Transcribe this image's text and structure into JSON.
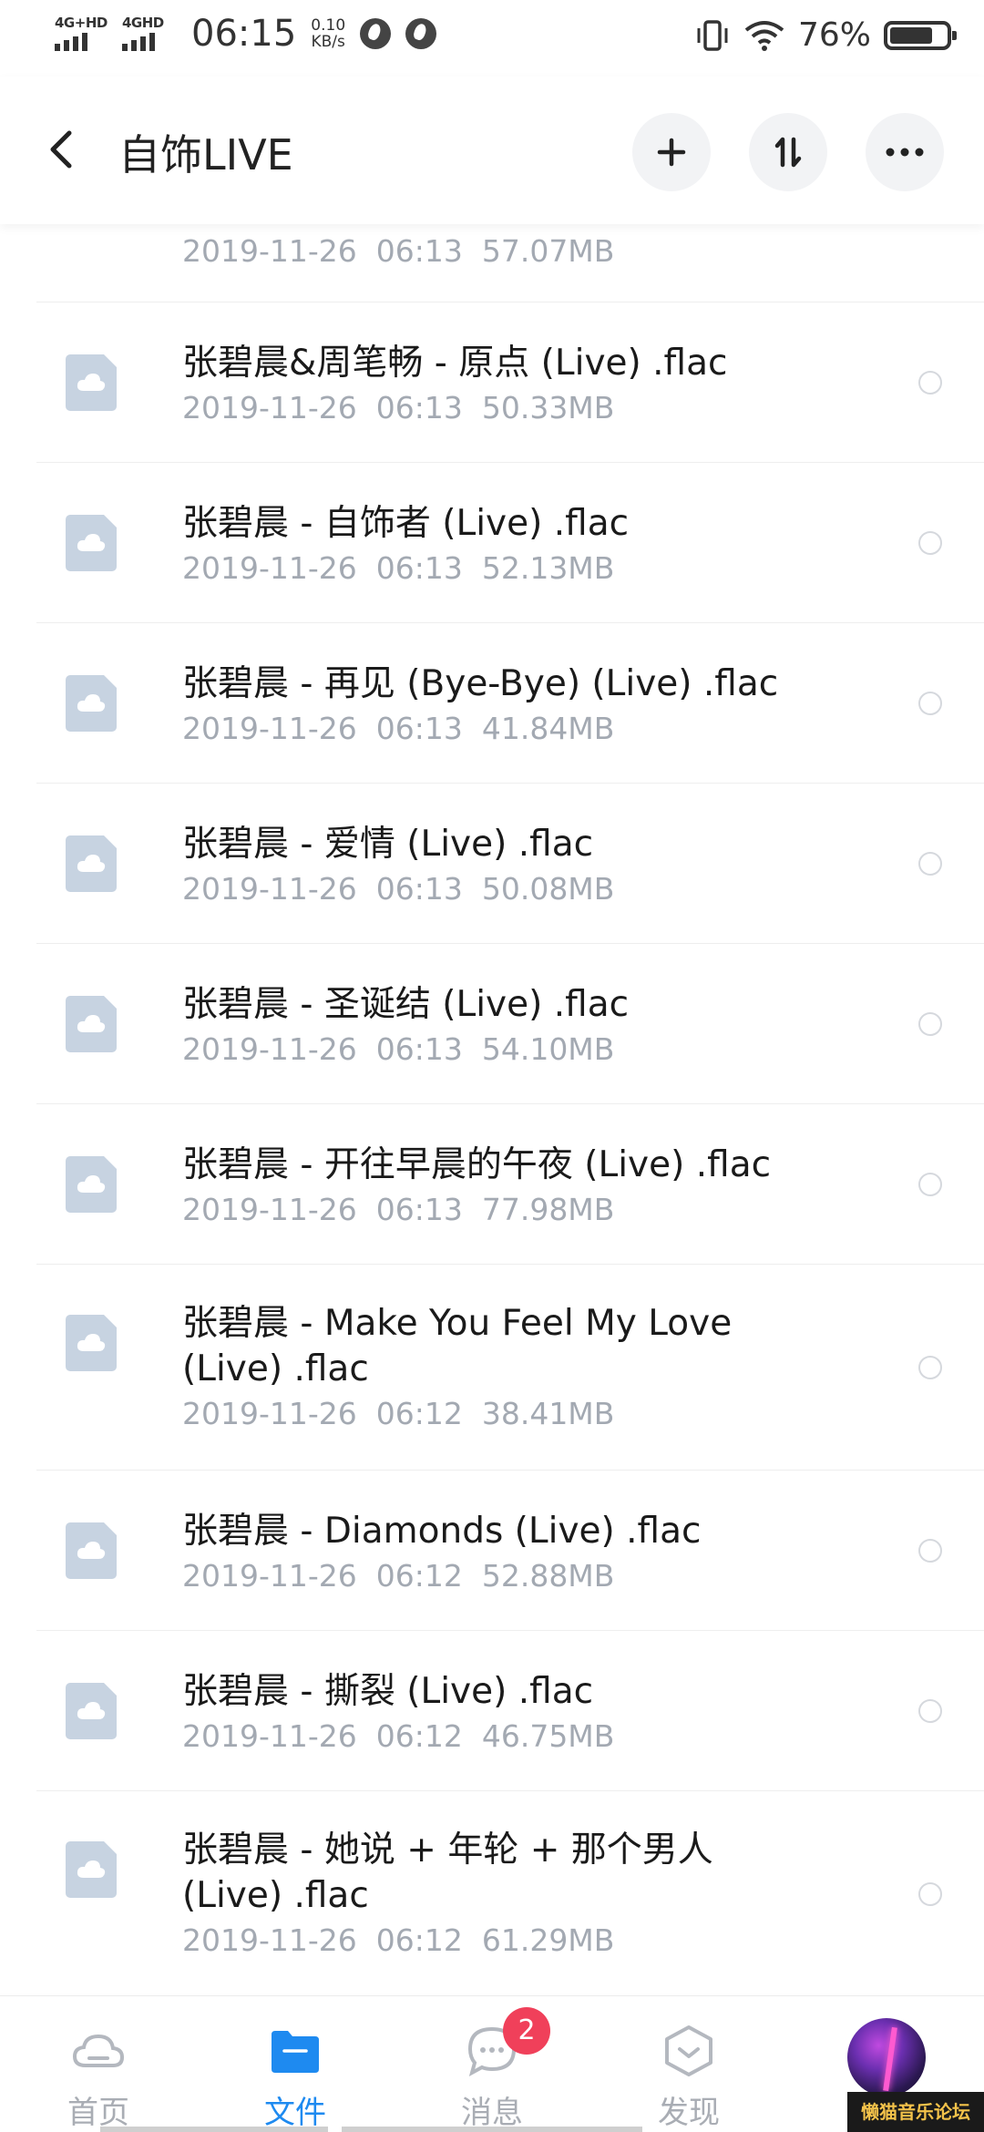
{
  "status_bar": {
    "sim1": "4G+HD",
    "sim2": "4GHD",
    "time": "06:15",
    "speed_value": "0.10",
    "speed_unit": "KB/s",
    "battery_percent": "76%",
    "battery_level": 0.76
  },
  "header": {
    "title": "自饰LIVE",
    "back_icon": "chevron-left-icon",
    "add_icon": "plus-icon",
    "sort_icon": "sort-icon",
    "more_icon": "more-icon"
  },
  "files": [
    {
      "name": "",
      "meta": "2019-11-26  06:13  57.07MB"
    },
    {
      "name": "张碧晨&周笔畅 - 原点 (Live) .flac",
      "meta": "2019-11-26  06:13  50.33MB"
    },
    {
      "name": "张碧晨 - 自饰者 (Live) .flac",
      "meta": "2019-11-26  06:13  52.13MB"
    },
    {
      "name": "张碧晨 - 再见 (Bye-Bye) (Live) .flac",
      "meta": "2019-11-26  06:13  41.84MB"
    },
    {
      "name": "张碧晨 - 爱情 (Live) .flac",
      "meta": "2019-11-26  06:13  50.08MB"
    },
    {
      "name": "张碧晨 - 圣诞结 (Live) .flac",
      "meta": "2019-11-26  06:13  54.10MB"
    },
    {
      "name": "张碧晨 - 开往早晨的午夜 (Live) .flac",
      "meta": "2019-11-26  06:13  77.98MB"
    },
    {
      "name": "张碧晨 - Make You Feel My Love (Live) .flac",
      "meta": "2019-11-26  06:12  38.41MB"
    },
    {
      "name": "张碧晨 - Diamonds (Live) .flac",
      "meta": "2019-11-26  06:12  52.88MB"
    },
    {
      "name": "张碧晨 - 撕裂 (Live) .flac",
      "meta": "2019-11-26  06:12  46.75MB"
    },
    {
      "name": "张碧晨 - 她说 + 年轮 + 那个男人 (Live) .flac",
      "meta": "2019-11-26  06:12  61.29MB"
    }
  ],
  "bottom_nav": {
    "home": "首页",
    "files": "文件",
    "messages": "消息",
    "discover": "发现",
    "messages_badge": "2",
    "active_color": "#1e8af0"
  },
  "watermark": "懒猫音乐论坛"
}
